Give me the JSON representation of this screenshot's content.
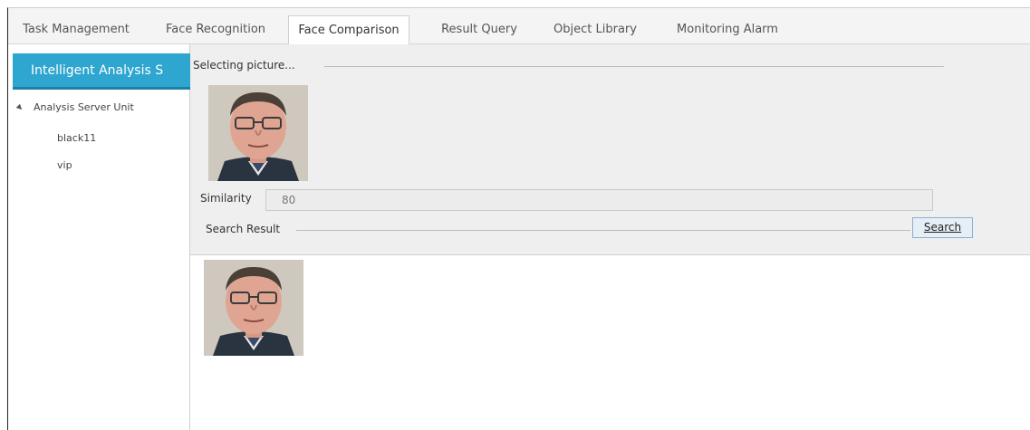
{
  "tabs": [
    {
      "label": "Task Management",
      "active": false
    },
    {
      "label": "Face Recognition",
      "active": false
    },
    {
      "label": "Face Comparison",
      "active": true
    },
    {
      "label": "Result Query",
      "active": false
    },
    {
      "label": "Object Library",
      "active": false
    },
    {
      "label": "Monitoring Alarm",
      "active": false
    }
  ],
  "sidebar": {
    "header": "Intelligent Analysis S",
    "tree": {
      "root": "Analysis Server Unit",
      "children": [
        "black11",
        "vip"
      ]
    }
  },
  "comparison": {
    "selecting_label": "Selecting picture...",
    "similarity_label": "Similarity",
    "similarity_value": "80",
    "search_result_label": "Search Result",
    "search_button": "Search"
  },
  "colors": {
    "accent": "#2ea6cf",
    "panel_bg": "#efefef"
  }
}
